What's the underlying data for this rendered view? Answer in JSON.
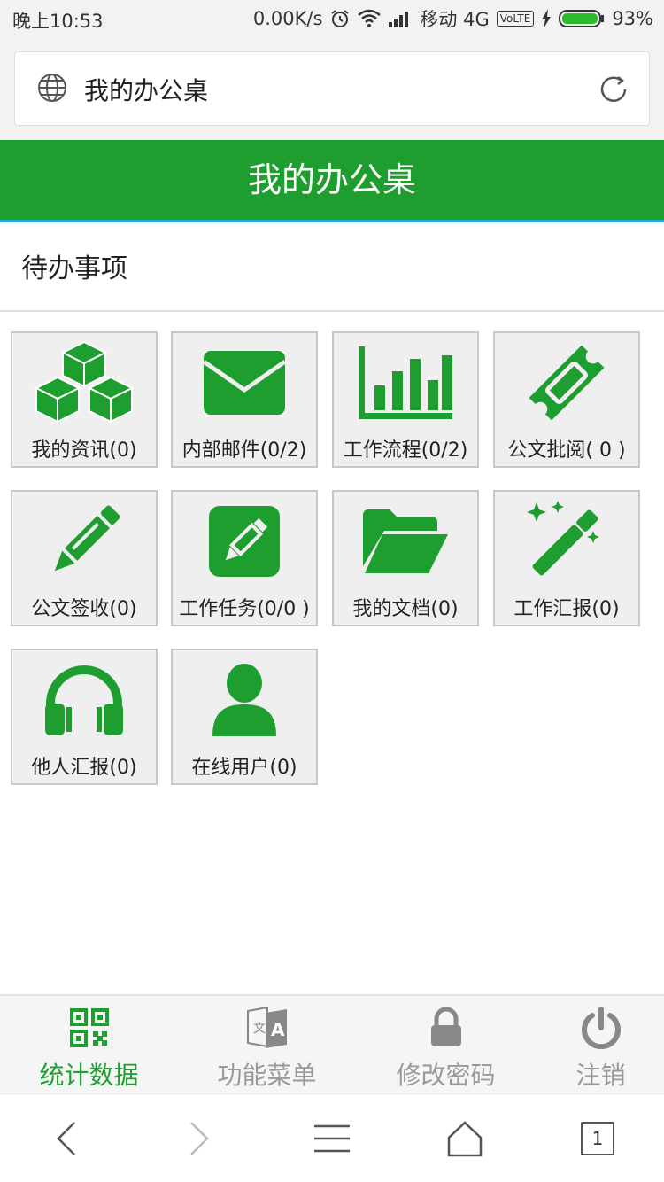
{
  "status_bar": {
    "time": "晚上10:53",
    "speed": "0.00K/s",
    "carrier": "移动 4G",
    "volte": "VoLTE",
    "battery": "93%"
  },
  "address_bar": {
    "title": "我的办公桌"
  },
  "header": {
    "title": "我的办公桌"
  },
  "section": {
    "title": "待办事项"
  },
  "tiles": [
    {
      "label": "我的资讯(0)",
      "icon": "cubes-icon"
    },
    {
      "label": "内部邮件(0/2)",
      "icon": "envelope-icon"
    },
    {
      "label": "工作流程(0/2)",
      "icon": "bar-chart-icon"
    },
    {
      "label": "公文批阅( 0 )",
      "icon": "ticket-icon"
    },
    {
      "label": "公文签收(0)",
      "icon": "pencil-icon"
    },
    {
      "label": "工作任务(0/0 )",
      "icon": "edit-square-icon"
    },
    {
      "label": "我的文档(0)",
      "icon": "folder-open-icon"
    },
    {
      "label": "工作汇报(0)",
      "icon": "magic-wand-icon"
    },
    {
      "label": "他人汇报(0)",
      "icon": "headphones-icon"
    },
    {
      "label": "在线用户(0)",
      "icon": "user-icon"
    }
  ],
  "tabs": [
    {
      "label": "统计数据",
      "icon": "qrcode-icon",
      "active": true
    },
    {
      "label": "功能菜单",
      "icon": "translate-icon",
      "active": false
    },
    {
      "label": "修改密码",
      "icon": "lock-icon",
      "active": false
    },
    {
      "label": "注销",
      "icon": "power-icon",
      "active": false
    }
  ],
  "nav": {
    "tab_count": "1"
  },
  "colors": {
    "brand_green": "#1e9e2e",
    "header_underline": "#2aa6d8",
    "tile_bg": "#efefef",
    "inactive_tab": "#999999"
  }
}
